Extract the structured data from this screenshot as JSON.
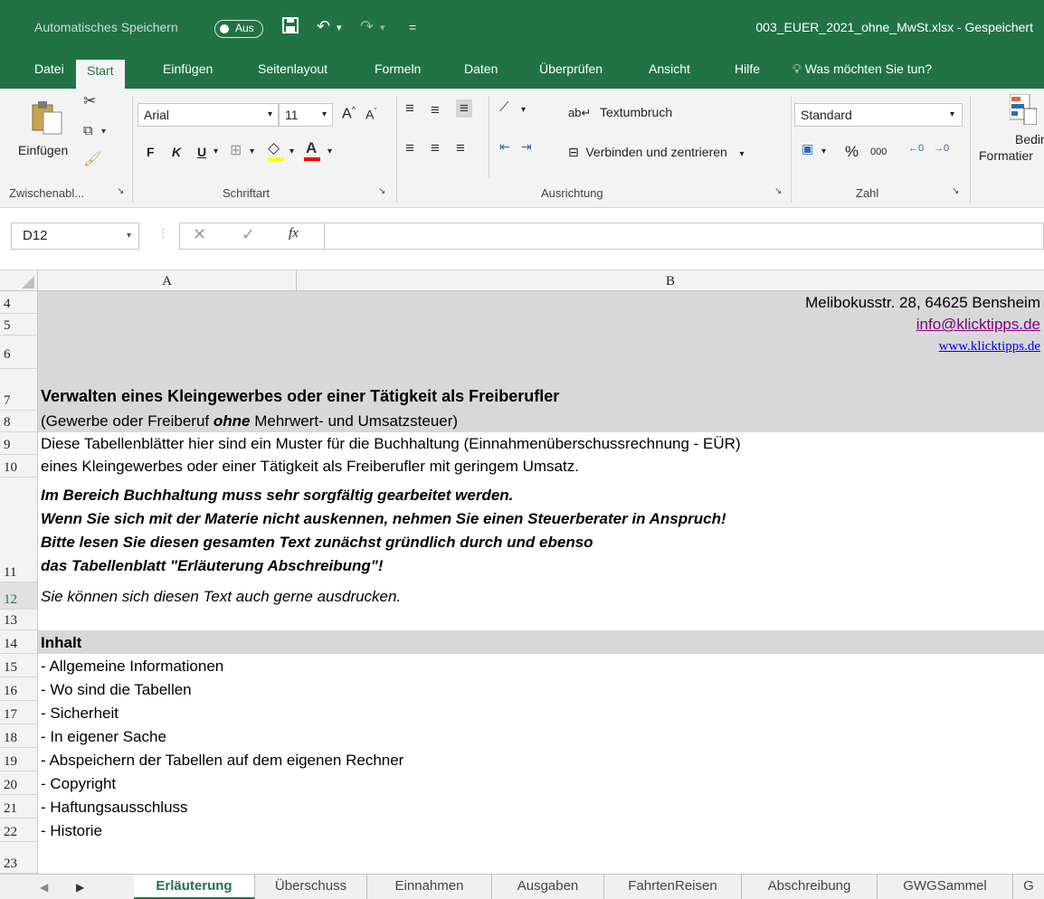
{
  "titlebar": {
    "autosave_label": "Automatisches Speichern",
    "autosave_state": "Aus",
    "filename": "003_EUER_2021_ohne_MwSt.xlsx - Gespeichert"
  },
  "ribbon_tabs": [
    "Datei",
    "Start",
    "Einfügen",
    "Seitenlayout",
    "Formeln",
    "Daten",
    "Überprüfen",
    "Ansicht",
    "Hilfe"
  ],
  "tell_me": "Was möchten Sie tun?",
  "ribbon": {
    "paste_label": "Einfügen",
    "clipboard_group": "Zwischenabl...",
    "font_name": "Arial",
    "font_size": "11",
    "bold": "F",
    "italic": "K",
    "underline": "U",
    "font_group": "Schriftart",
    "wrap_text": "Textumbruch",
    "merge_center": "Verbinden und zentrieren",
    "alignment_group": "Ausrichtung",
    "number_format": "Standard",
    "percent": "%",
    "thousands": "000",
    "number_group": "Zahl",
    "cond_format_line1": "Beding",
    "cond_format_line2": "Formatier"
  },
  "formula_bar": {
    "name_box": "D12",
    "fx": "fx",
    "formula": ""
  },
  "columns": [
    "A",
    "B"
  ],
  "rows": {
    "r4": {
      "num": "4",
      "text": "Melibokusstr. 28, 64625 Bensheim"
    },
    "r5": {
      "num": "5",
      "text": "info@klicktipps.de"
    },
    "r6": {
      "num": "6",
      "text": "www.klicktipps.de"
    },
    "r7": {
      "num": "7",
      "text": "Verwalten eines Kleingewerbes oder einer Tätigkeit als Freiberufler"
    },
    "r8": {
      "num": "8",
      "text_pre": "(Gewerbe oder Freiberuf ",
      "text_em": "ohne",
      "text_post": " Mehrwert- und Umsatzsteuer)"
    },
    "r9": {
      "num": "9",
      "text": "Diese Tabellenblätter hier sind ein Muster für die Buchhaltung (Einnahmenüberschussrechnung - EÜR)"
    },
    "r10": {
      "num": "10",
      "text": "eines Kleingewerbes oder einer Tätigkeit als Freiberufler mit geringem Umsatz."
    },
    "r11": {
      "num": "11",
      "lines": [
        "Im Bereich Buchhaltung muss sehr sorgfältig gearbeitet werden.",
        "Wenn Sie sich mit der Materie nicht auskennen, nehmen Sie einen Steuerberater in Anspruch!",
        "Bitte lesen Sie diesen gesamten Text zunächst gründlich durch und ebenso",
        "das Tabellenblatt \"Erläuterung Abschreibung\"!"
      ]
    },
    "r12": {
      "num": "12",
      "text": "Sie können sich diesen Text auch gerne ausdrucken."
    },
    "r13": {
      "num": "13",
      "text": ""
    },
    "r14": {
      "num": "14",
      "text": "Inhalt"
    },
    "r15": {
      "num": "15",
      "text": "- Allgemeine Informationen"
    },
    "r16": {
      "num": "16",
      "text": "- Wo sind die Tabellen"
    },
    "r17": {
      "num": "17",
      "text": "- Sicherheit"
    },
    "r18": {
      "num": "18",
      "text": "- In eigener Sache"
    },
    "r19": {
      "num": "19",
      "text": "- Abspeichern der Tabellen auf dem eigenen Rechner"
    },
    "r20": {
      "num": "20",
      "text": "- Copyright"
    },
    "r21": {
      "num": "21",
      "text": "- Haftungsausschluss"
    },
    "r22": {
      "num": "22",
      "text": "- Historie"
    },
    "r23": {
      "num": "23",
      "text": ""
    }
  },
  "sheet_tabs": [
    "Erläuterung",
    "Überschuss",
    "Einnahmen",
    "Ausgaben",
    "FahrtenReisen",
    "Abschreibung",
    "GWGSammel",
    "G"
  ],
  "colors": {
    "accent": "#217346",
    "link_email": "#800080",
    "link_web": "#0000ff"
  }
}
